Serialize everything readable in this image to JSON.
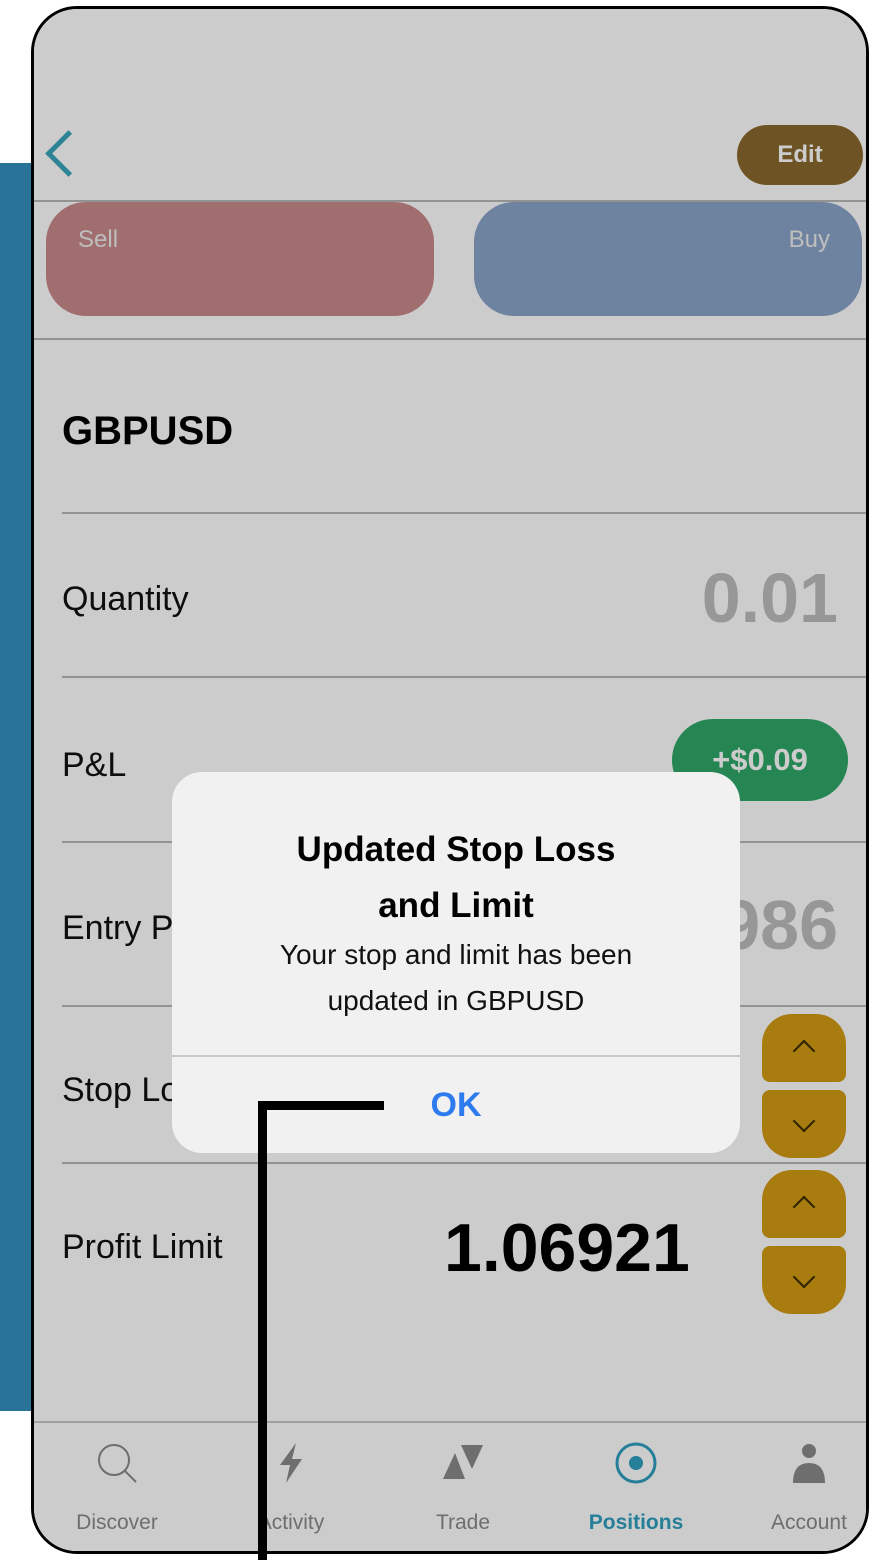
{
  "header": {
    "edit_label": "Edit"
  },
  "trade": {
    "sell_label": "Sell",
    "buy_label": "Buy"
  },
  "position": {
    "symbol": "GBPUSD",
    "quantity_label": "Quantity",
    "quantity_value": "0.01",
    "pl_label": "P&L",
    "pl_value": "+$0.09",
    "entry_label": "Entry P",
    "entry_value": "986",
    "stop_label": "Stop Lo",
    "profit_label": "Profit Limit",
    "profit_value": "1.06921"
  },
  "alert": {
    "title_line1": "Updated Stop Loss",
    "title_line2": "and Limit",
    "message_line1": "Your stop and limit has been",
    "message_line2": "updated in GBPUSD",
    "ok_label": "OK"
  },
  "nav": {
    "items": [
      {
        "label": "Discover",
        "icon": "search-icon"
      },
      {
        "label": "Activity",
        "icon": "lightning-icon"
      },
      {
        "label": "Trade",
        "icon": "trade-triangles-icon"
      },
      {
        "label": "Positions",
        "icon": "target-icon",
        "active": true
      },
      {
        "label": "Account",
        "icon": "person-icon"
      }
    ]
  },
  "colors": {
    "accent": "#2f9fbf",
    "edit": "#8a6a2e",
    "pl_positive": "#2fa86a",
    "stepper": "#d49b14",
    "side_panel": "#2a7398",
    "ok": "#2e7bf0"
  }
}
